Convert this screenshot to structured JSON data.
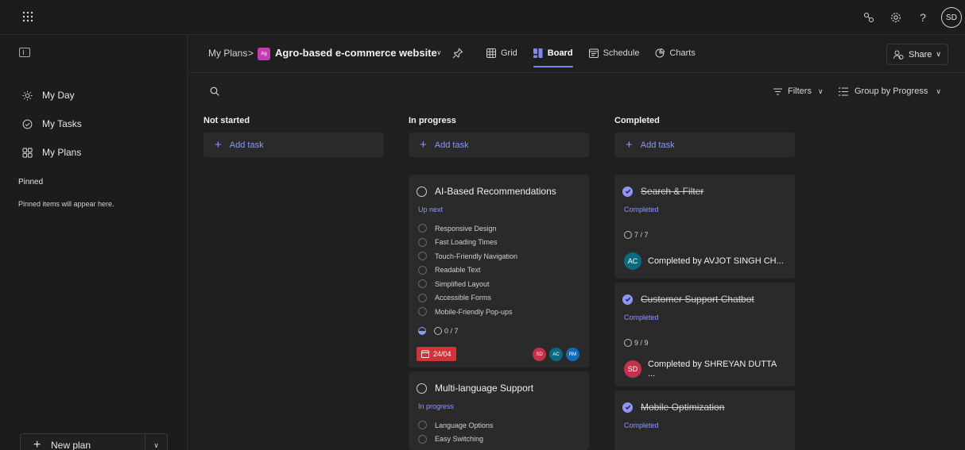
{
  "topbar": {
    "icons": [
      "app-launcher-icon",
      "share-link-icon",
      "settings-icon",
      "help-icon"
    ],
    "help_glyph": "?",
    "avatar_initials": "SD"
  },
  "sidebar": {
    "items": [
      {
        "label": "My Day",
        "icon": "sun-icon"
      },
      {
        "label": "My Tasks",
        "icon": "check-circle-icon"
      },
      {
        "label": "My Plans",
        "icon": "grid-icon"
      }
    ],
    "pinned_heading": "Pinned",
    "pinned_empty": "Pinned items will appear here.",
    "new_plan_label": "New plan"
  },
  "header": {
    "breadcrumb": "My Plans",
    "separator": ">",
    "plan_logo_text": "Ag",
    "plan_title": "Agro-based e-commerce website",
    "tabs": [
      {
        "label": "Grid",
        "icon": "grid-icon",
        "active": false
      },
      {
        "label": "Board",
        "icon": "board-icon",
        "active": true
      },
      {
        "label": "Schedule",
        "icon": "calendar-icon",
        "active": false
      },
      {
        "label": "Charts",
        "icon": "chart-icon",
        "active": false
      }
    ],
    "share_label": "Share"
  },
  "toolbar": {
    "filters_label": "Filters",
    "group_label": "Group by Progress"
  },
  "columns": [
    {
      "title": "Not started",
      "add_label": "Add task"
    },
    {
      "title": "In progress",
      "add_label": "Add task"
    },
    {
      "title": "Completed",
      "add_label": "Add task"
    }
  ],
  "cards": {
    "ai": {
      "title": "AI-Based Recommendations",
      "label": "Up next",
      "checklist": [
        "Responsive Design",
        "Fast Loading Times",
        "Touch-Friendly Navigation",
        "Readable Text",
        "Simplified Layout",
        "Accessible Forms",
        "Mobile-Friendly Pop-ups"
      ],
      "count": "0 / 7",
      "due": "24/04",
      "assignees": [
        {
          "initials": "SD",
          "color": "#c4314b"
        },
        {
          "initials": "AC",
          "color": "#0b6a80"
        },
        {
          "initials": "RM",
          "color": "#0f6cbd"
        }
      ]
    },
    "multi": {
      "title": "Multi-language Support",
      "label": "In progress",
      "checklist": [
        "Language Options",
        "Easy Switching"
      ]
    },
    "search": {
      "title": "Search & Filter",
      "label": "Completed",
      "count": "7 / 7",
      "completed_by": "Completed by AVJOT SINGH CH...",
      "initials": "AC",
      "color": "#0b6a80"
    },
    "chatbot": {
      "title": "Customer Support Chatbot",
      "label": "Completed",
      "count": "9 / 9",
      "completed_by": "Completed by SHREYAN DUTTA ...",
      "initials": "SD",
      "color": "#c4314b"
    },
    "mobile": {
      "title": "Mobile Optimization",
      "label": "Completed"
    }
  }
}
